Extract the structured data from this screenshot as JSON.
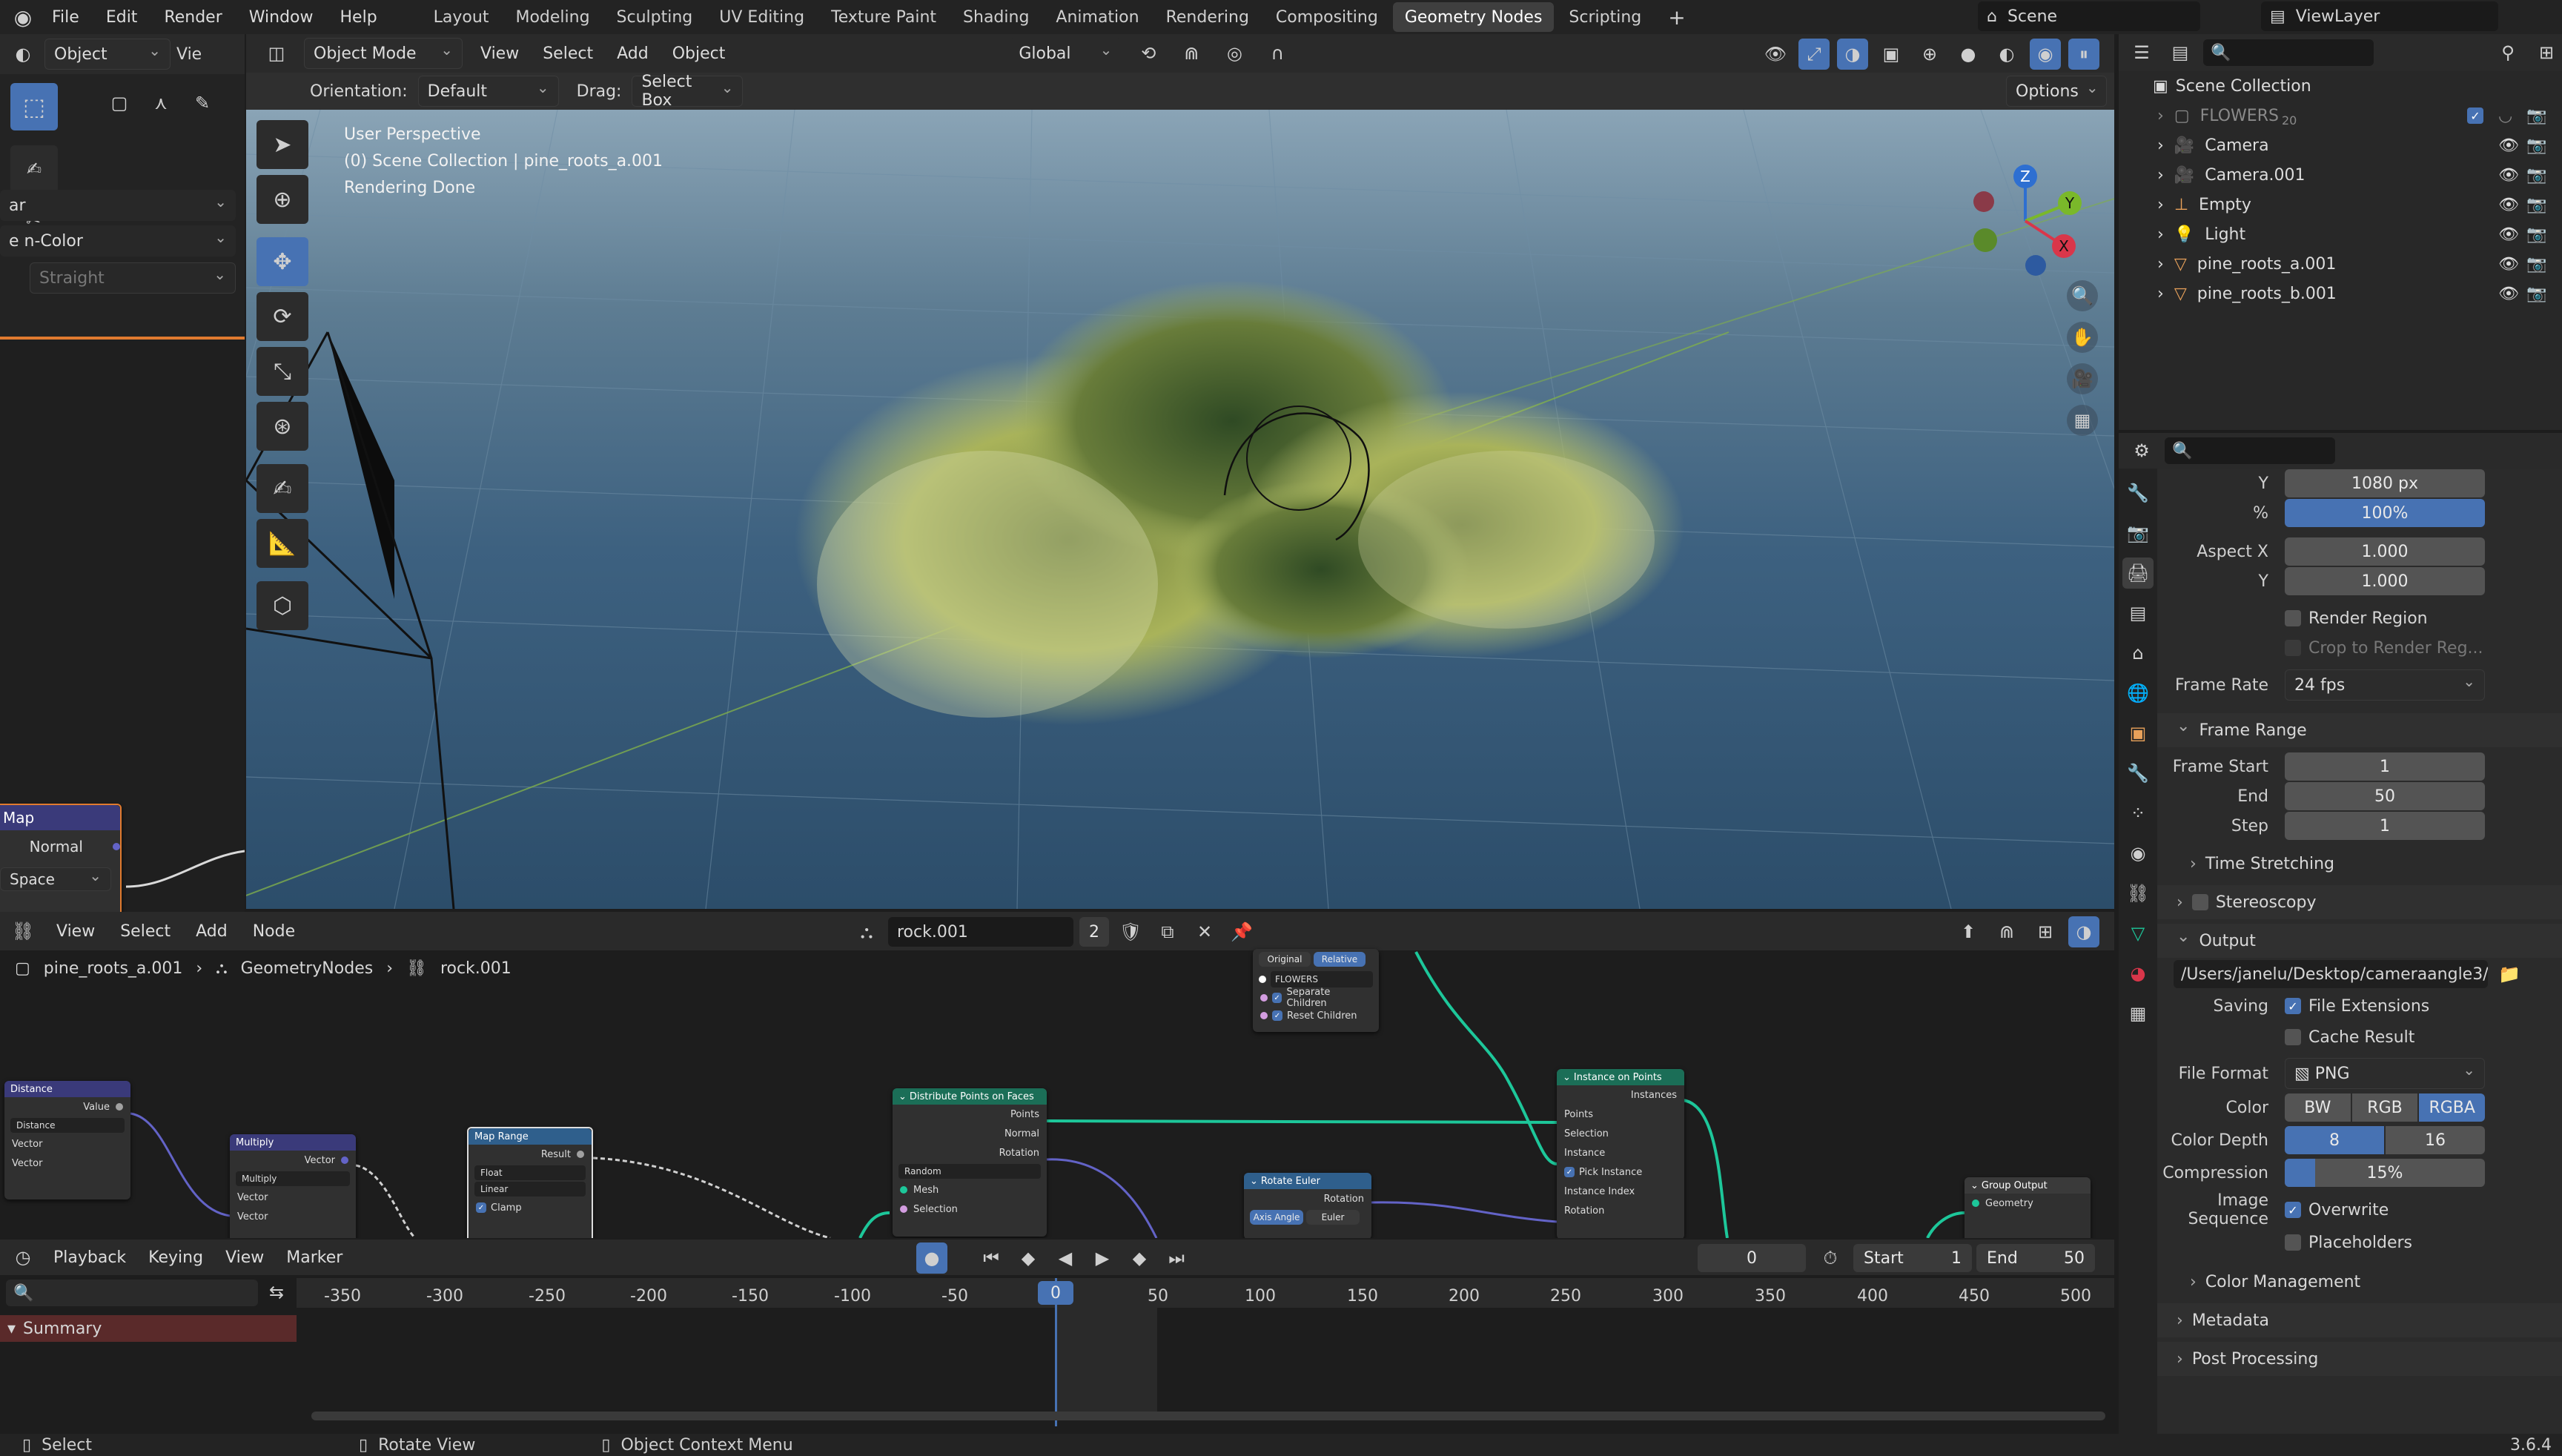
{
  "top_menu": [
    "File",
    "Edit",
    "Render",
    "Window",
    "Help"
  ],
  "workspaces": [
    "Layout",
    "Modeling",
    "Sculpting",
    "UV Editing",
    "Texture Paint",
    "Shading",
    "Animation",
    "Rendering",
    "Compositing",
    "Geometry Nodes",
    "Scripting"
  ],
  "active_workspace": "Geometry Nodes",
  "scene_name": "Scene",
  "view_layer": "ViewLayer",
  "left_panel": {
    "mode": "Object",
    "view_label": "Vie",
    "field_a": "ar",
    "field_b": "e",
    "field_b_value": "n-Color",
    "straight": "Straight",
    "map_node": {
      "title": "Map",
      "normal": "Normal",
      "space": "Space"
    }
  },
  "viewport": {
    "mode": "Object Mode",
    "menus": [
      "View",
      "Select",
      "Add",
      "Object"
    ],
    "transform": "Global",
    "orientation_label": "Orientation:",
    "orientation_value": "Default",
    "drag_label": "Drag:",
    "drag_value": "Select Box",
    "options": "Options",
    "overlay_line1": "User Perspective",
    "overlay_line2": "(0) Scene Collection | pine_roots_a.001",
    "overlay_line3": "Rendering Done",
    "gizmo": {
      "z": "Z",
      "y": "Y",
      "x": "X"
    }
  },
  "node_editor": {
    "menus": [
      "View",
      "Select",
      "Add",
      "Node"
    ],
    "node_group": "rock.001",
    "users": "2",
    "breadcrumb": [
      "pine_roots_a.001",
      "GeometryNodes",
      "rock.001"
    ],
    "nodes": {
      "collection_info": {
        "original": "Original",
        "relative": "Relative",
        "collection": "FLOWERS",
        "separate": "Separate Children",
        "reset": "Reset Children"
      },
      "distance": {
        "title": "Distance",
        "value": "Value",
        "mode": "Distance",
        "in1": "Vector",
        "in2": "Vector"
      },
      "multiply": {
        "title": "Multiply",
        "out": "Vector",
        "mode": "Multiply",
        "in1": "Vector",
        "in2": "Vector"
      },
      "map_range": {
        "title": "Map Range",
        "out": "Result",
        "type": "Float",
        "interp": "Linear",
        "clamp": "Clamp"
      },
      "distribute": {
        "title": "Distribute Points on Faces",
        "points": "Points",
        "normal": "Normal",
        "rotation": "Rotation",
        "mode": "Random",
        "mesh": "Mesh",
        "selection": "Selection"
      },
      "rotate_euler": {
        "title": "Rotate Euler",
        "rotation": "Rotation",
        "axis_angle": "Axis Angle",
        "euler": "Euler"
      },
      "instance_on_points": {
        "title": "Instance on Points",
        "instances": "Instances",
        "points": "Points",
        "selection": "Selection",
        "instance": "Instance",
        "pick": "Pick Instance",
        "index": "Instance Index",
        "rotation": "Rotation"
      },
      "group_output": {
        "title": "Group Output",
        "geometry": "Geometry"
      }
    }
  },
  "timeline": {
    "menus": [
      "Playback",
      "Keying",
      "View",
      "Marker"
    ],
    "current_frame": "0",
    "start_label": "Start",
    "start": "1",
    "end_label": "End",
    "end": "50",
    "ruler": [
      "-350",
      "-300",
      "-250",
      "-200",
      "-150",
      "-100",
      "-50",
      "0",
      "50",
      "100",
      "150",
      "200",
      "250",
      "300",
      "350",
      "400",
      "450",
      "500"
    ],
    "summary": "Summary"
  },
  "outliner": {
    "root": "Scene Collection",
    "items": [
      {
        "name": "FLOWERS",
        "badge": "20",
        "dim": true
      },
      {
        "name": "Camera"
      },
      {
        "name": "Camera.001"
      },
      {
        "name": "Empty"
      },
      {
        "name": "Light"
      },
      {
        "name": "pine_roots_a.001"
      },
      {
        "name": "pine_roots_b.001"
      }
    ]
  },
  "properties": {
    "res_y_label": "Y",
    "res_y": "1080 px",
    "pct_label": "%",
    "pct": "100%",
    "aspect_x_label": "Aspect X",
    "aspect_x": "1.000",
    "aspect_y_label": "Y",
    "aspect_y": "1.000",
    "render_region": "Render Region",
    "crop": "Crop to Render Reg...",
    "frame_rate_label": "Frame Rate",
    "frame_rate": "24 fps",
    "frame_range": "Frame Range",
    "frame_start_label": "Frame Start",
    "frame_start": "1",
    "end_label": "End",
    "end": "50",
    "step_label": "Step",
    "step": "1",
    "time_stretching": "Time Stretching",
    "stereoscopy": "Stereoscopy",
    "output": "Output",
    "output_path": "/Users/janelu/Desktop/cameraangle3/",
    "saving_label": "Saving",
    "file_extensions": "File Extensions",
    "cache_result": "Cache Result",
    "file_format_label": "File Format",
    "file_format": "PNG",
    "color_label": "Color",
    "color_options": [
      "BW",
      "RGB",
      "RGBA"
    ],
    "color_depth_label": "Color Depth",
    "color_depth_options": [
      "8",
      "16"
    ],
    "compression_label": "Compression",
    "compression": "15%",
    "compression_fraction": 0.15,
    "image_sequence_label": "Image Sequence",
    "overwrite": "Overwrite",
    "placeholders": "Placeholders",
    "color_management": "Color Management",
    "metadata": "Metadata",
    "post_processing": "Post Processing"
  },
  "status_bar": {
    "select": "Select",
    "rotate": "Rotate View",
    "context": "Object Context Menu",
    "version": "3.6.4"
  },
  "colors": {
    "accent": "#4772b3",
    "node_green": "#1dc79a",
    "geometry_node_header": "#1b6e57",
    "input_node_header": "#3a3a7a",
    "converter_header": "#2f5f8c"
  }
}
